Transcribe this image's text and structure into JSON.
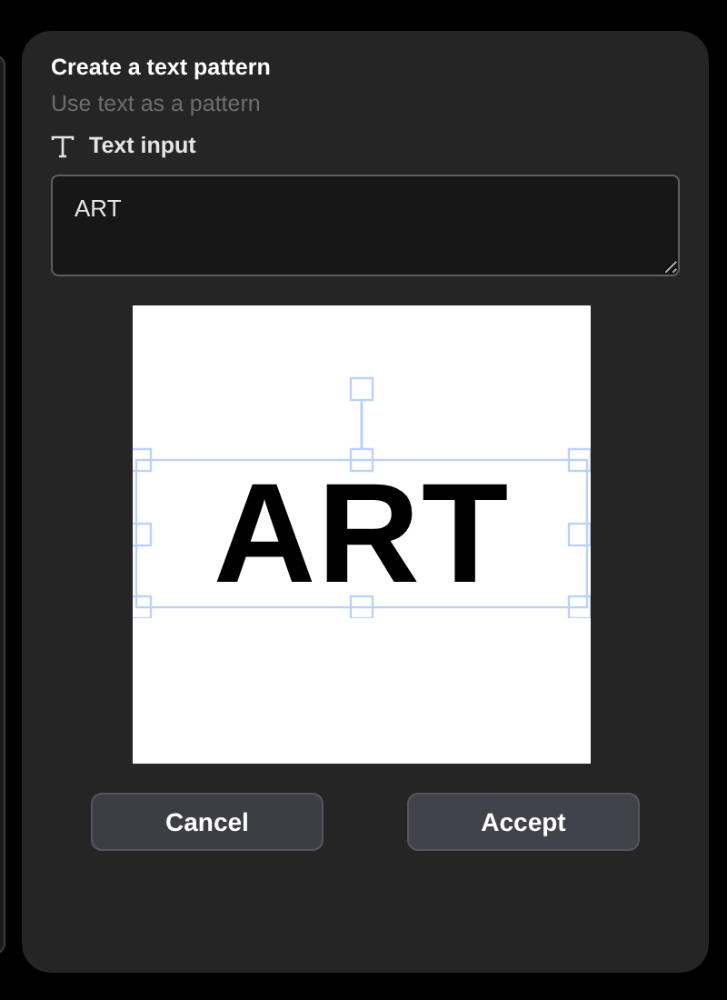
{
  "dialog": {
    "title": "Create a text pattern",
    "subtitle": "Use text as a pattern",
    "field": {
      "label": "Text input",
      "value": "ART"
    },
    "preview": {
      "text": "ART",
      "selected": true
    },
    "buttons": [
      {
        "label": "Cancel",
        "kind": "secondary"
      },
      {
        "label": "Accept",
        "kind": "primary"
      }
    ]
  }
}
